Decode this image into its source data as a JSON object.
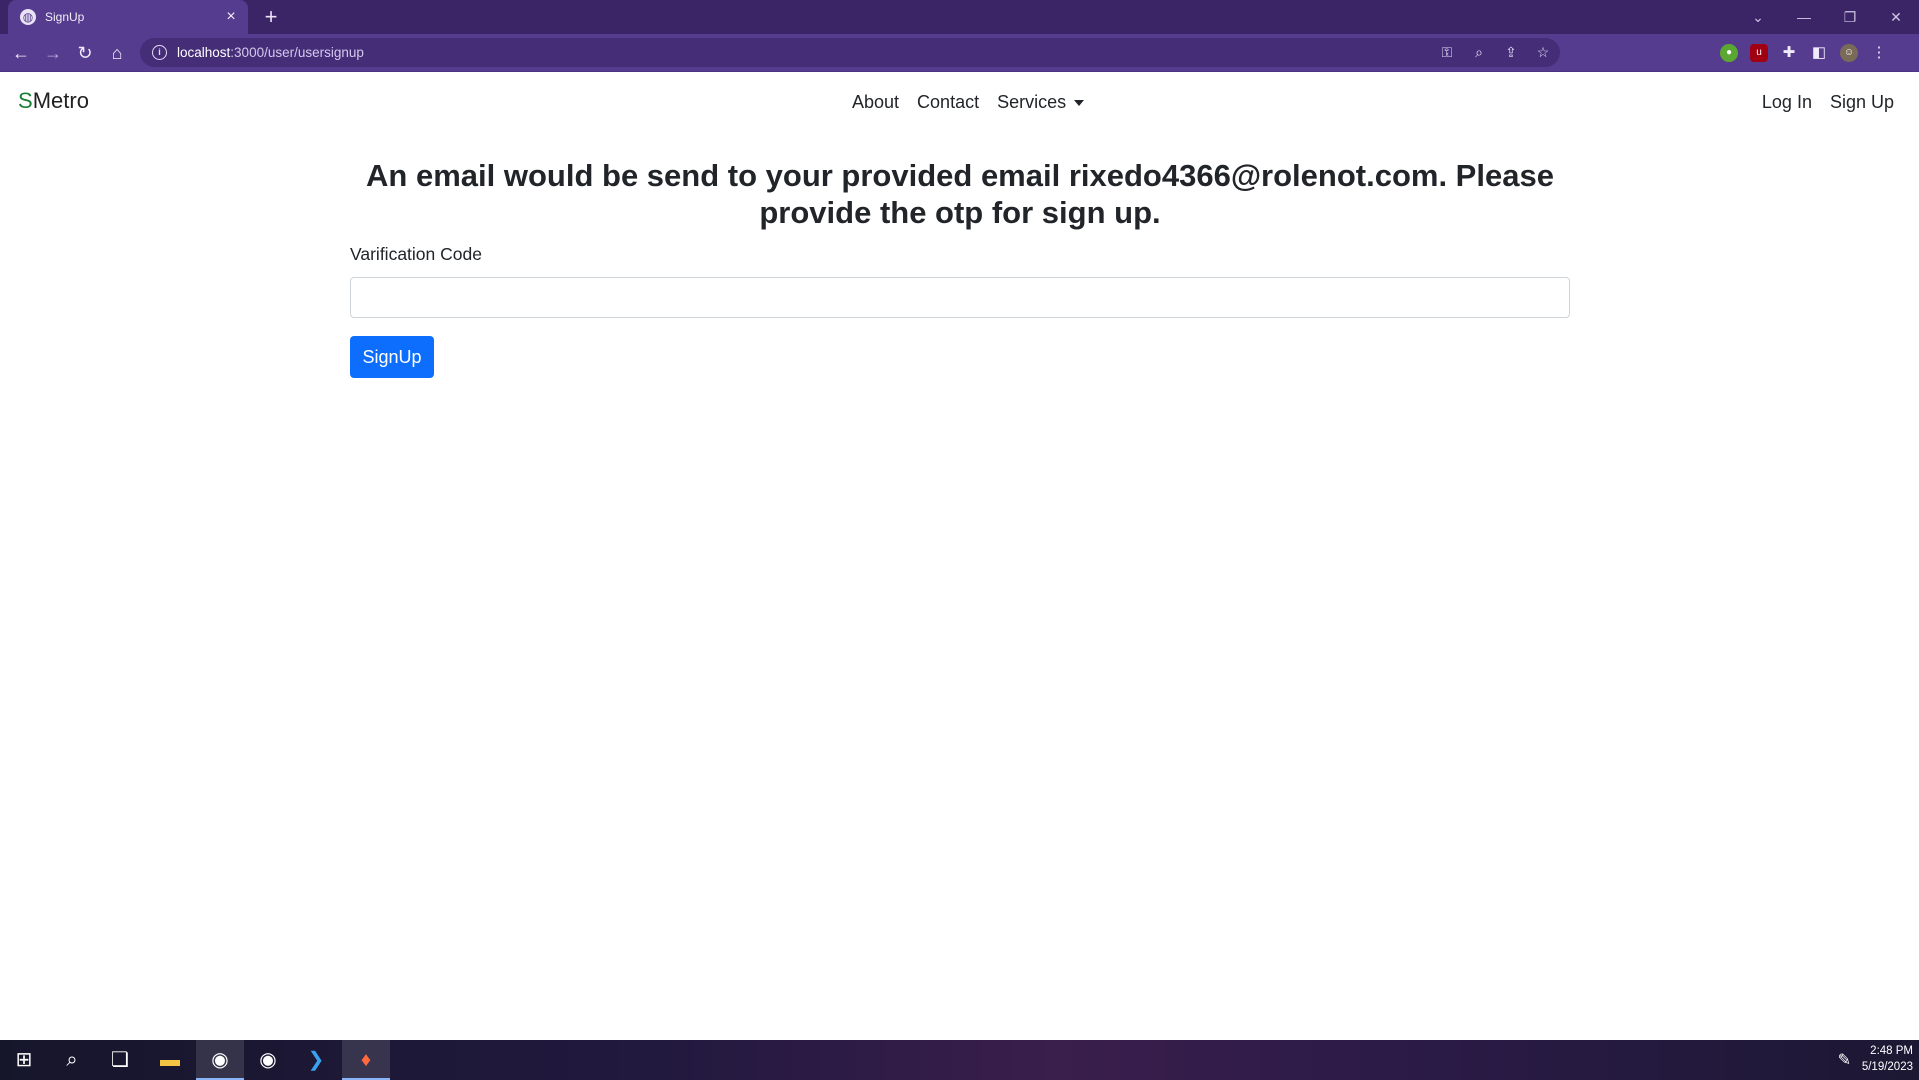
{
  "browser": {
    "tab_title": "SignUp",
    "tab_close": "×",
    "new_tab": "+",
    "url_host": "localhost",
    "url_rest": ":3000/user/usersignup",
    "window_controls": [
      "⌄",
      "—",
      "❐",
      "✕"
    ]
  },
  "navbar": {
    "brand_s": "S",
    "brand_rest": "Metro",
    "links": [
      "About",
      "Contact",
      "Services"
    ],
    "right_links": [
      "Log In",
      "Sign Up"
    ]
  },
  "main": {
    "headline": "An email would be send to your provided email rixedo4366@rolenot.com. Please provide the otp for sign up.",
    "field_label": "Varification Code",
    "field_value": "",
    "button_label": "SignUp"
  },
  "taskbar": {
    "time": "2:48 PM",
    "date": "5/19/2023"
  },
  "colors": {
    "browser_frame": "#3b2566",
    "browser_toolbar": "#563c8e",
    "primary_button": "#0d6efd",
    "brand_s": "#1a7f37"
  }
}
